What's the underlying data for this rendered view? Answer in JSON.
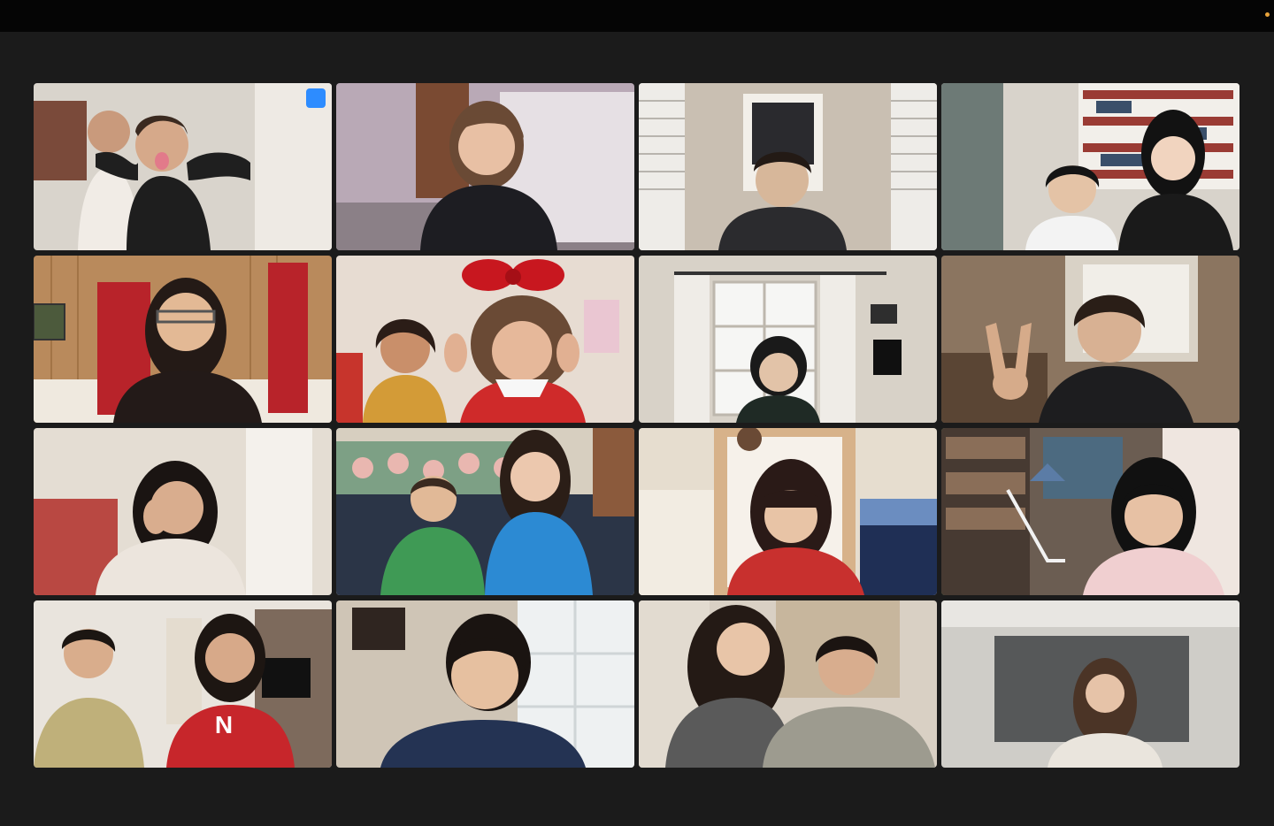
{
  "window": {
    "title": ""
  },
  "tile_menu": {
    "label": "•••"
  },
  "colors": {
    "active_speaker": "#2fbf4a",
    "menu_button": "#2d8cff",
    "background": "#1b1b1b",
    "titlebar": "#050505"
  },
  "participants": [
    {
      "id": 1,
      "people": 2,
      "scene": "playroom"
    },
    {
      "id": 2,
      "people": 1,
      "scene": "living-room"
    },
    {
      "id": 3,
      "people": 1,
      "scene": "window-shutters"
    },
    {
      "id": 4,
      "people": 2,
      "scene": "bookshelf"
    },
    {
      "id": 5,
      "people": 1,
      "scene": "wood-paneling"
    },
    {
      "id": 6,
      "people": 2,
      "scene": "bedroom"
    },
    {
      "id": 7,
      "people": 1,
      "scene": "window-curtains"
    },
    {
      "id": 8,
      "people": 1,
      "scene": "dim-room"
    },
    {
      "id": 9,
      "people": 1,
      "scene": "playroom"
    },
    {
      "id": 10,
      "people": 2,
      "scene": "kitchen-booth"
    },
    {
      "id": 11,
      "people": 1,
      "scene": "kitchen"
    },
    {
      "id": 12,
      "people": 1,
      "scene": "study",
      "active": true
    },
    {
      "id": 13,
      "people": 2,
      "scene": "fireplace"
    },
    {
      "id": 14,
      "people": 1,
      "scene": "window"
    },
    {
      "id": 15,
      "people": 2,
      "scene": "dining-room"
    },
    {
      "id": 16,
      "people": 1,
      "scene": "blurred-background"
    }
  ]
}
